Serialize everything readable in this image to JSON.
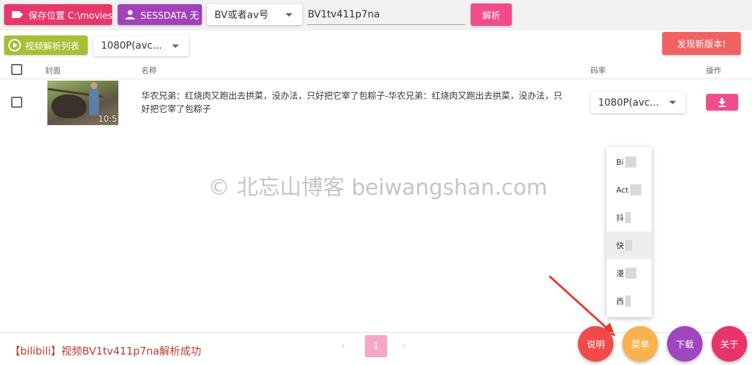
{
  "toolbar": {
    "save_location": "保存位置 C:\\movies",
    "sessdata": "SESSDATA 无",
    "type_select": "BV或者av号",
    "bv_input": "BV1tv411p7na",
    "parse": "解析"
  },
  "subbar": {
    "video_list": "视频解析列表",
    "quality": "1080P(avc...",
    "new_version": "发现新版本!"
  },
  "table": {
    "headers": {
      "cover": "封面",
      "name": "名称",
      "bitrate": "码率",
      "action": "操作"
    },
    "rows": [
      {
        "duration": "10:5",
        "title": "华农兄弟：红烧肉又跑出去拱菜，没办法，只好把它宰了包粽子-华农兄弟：红烧肉又跑出去拱菜，没办法，只好把它宰了包粽子",
        "quality": "1080P(avc..."
      }
    ]
  },
  "watermark": "© 北忘山博客 beiwangshan.com",
  "menu": {
    "items": [
      {
        "label": "Bi"
      },
      {
        "label": "Act"
      },
      {
        "label": "抖"
      },
      {
        "label": "快"
      },
      {
        "label": "漫"
      },
      {
        "label": "西"
      }
    ]
  },
  "status": {
    "message": "【bilibili】视频BV1tv411p7na解析成功"
  },
  "pager": {
    "prev": "‹",
    "page": "1",
    "next": "›"
  },
  "fabs": {
    "help": "说明",
    "menu": "菜单",
    "download": "下载",
    "about": "关于"
  },
  "colors": {
    "save_button": "#e8376b",
    "sessdata_button": "#a142b8",
    "parse_button": "#f04c8c",
    "list_button": "#a6bf34",
    "new_version_button": "#f06262",
    "status_text": "#c0392b",
    "arrow": "#e53935"
  },
  "icons": {
    "save": "label-tag-icon",
    "sessdata": "person-icon",
    "video_list": "play-circle-icon",
    "download": "download-icon"
  }
}
